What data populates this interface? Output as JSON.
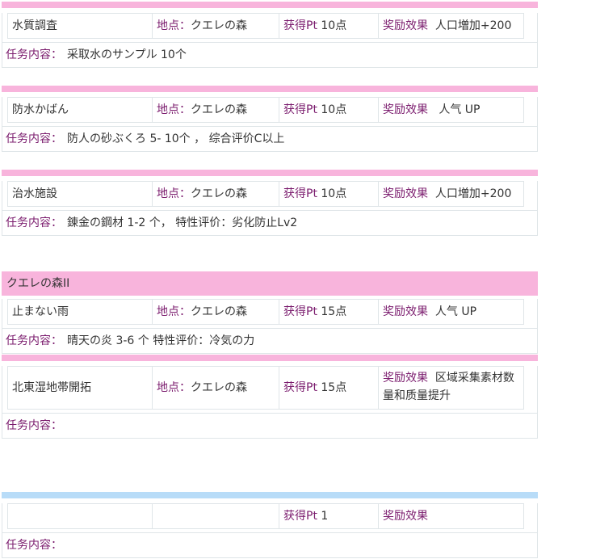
{
  "location_label": "地点：",
  "points_label": "获得Pt",
  "reward_label": "奖励效果",
  "task_label": "任务内容：",
  "colors": {
    "pink_bar": "#f8b4dc",
    "blue_bar": "#b8dcf8",
    "label": "#7b1c6e"
  },
  "quests": [
    {
      "name": "水質調査",
      "location": "クエレの森",
      "points": "10点",
      "reward": "人口増加+200",
      "task": "采取水のサンプル 10个"
    },
    {
      "name": "防水かばん",
      "location": "クエレの森",
      "points": "10点",
      "reward": "人气 UP",
      "task": "防人の砂ぶくろ 5- 10个 ， 综合评价C以上"
    },
    {
      "name": "治水施設",
      "location": "クエレの森",
      "points": "10点",
      "reward": "人口増加+200",
      "task": "錬金の鋼材 1-2 个， 特性评价：劣化防止Lv2"
    }
  ],
  "section2": {
    "header": "クエレの森II",
    "quests": [
      {
        "name": "止まない雨",
        "location": "クエレの森",
        "points": "15点",
        "reward": "人气 UP",
        "task": "晴天の炎 3-6 个 特性评价：冷気の力"
      },
      {
        "name": "北東湿地帯開拓",
        "location": "クエレの森",
        "points": "15点",
        "reward": "区域采集素材数量和质量提升",
        "task": ""
      }
    ]
  },
  "section3": {
    "quest": {
      "name": "",
      "location": "",
      "points": "1",
      "reward": "",
      "task": ""
    }
  }
}
